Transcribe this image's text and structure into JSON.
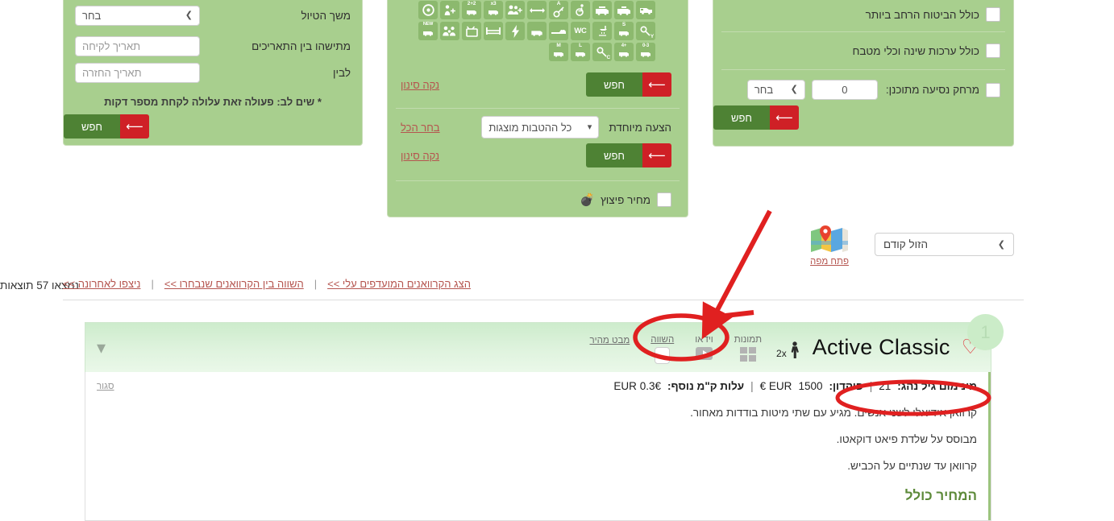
{
  "colors": {
    "panel_green": "#a8cf8e",
    "button_green": "#4e8234",
    "button_red": "#cf2026",
    "link_red": "#b5554f",
    "accent_green": "#5d8a39",
    "annotation_red": "#e02020"
  },
  "trip_panel": {
    "rows": [
      {
        "label": "משך הטיול",
        "value": "בחר",
        "type": "select"
      },
      {
        "label": "מתישהו בין התאריכים",
        "value": "תאריך לקיחה",
        "type": "date"
      },
      {
        "label": "לבין",
        "value": "תאריך החזרה",
        "type": "date"
      }
    ],
    "note": "* שים לב: פעולה זאת עלולה לקחת מספר דקות",
    "search_label": "חפש",
    "arrow_icon": "arrow-left-icon"
  },
  "features_panel": {
    "icons": [
      {
        "name": "van-icon",
        "sup": "",
        "text": ""
      },
      {
        "name": "camper-icon",
        "sup": "",
        "text": ""
      },
      {
        "name": "camper-plus-icon",
        "sup": "",
        "text": ""
      },
      {
        "name": "wheelchair-icon",
        "sup": "",
        "text": ""
      },
      {
        "name": "key-automatic-icon",
        "sup": "A",
        "text": ""
      },
      {
        "name": "length-icon",
        "sup": "",
        "text": ""
      },
      {
        "name": "people-plus-icon",
        "sup": "",
        "text": ""
      },
      {
        "name": "camper-x3-icon",
        "sup": "",
        "text": "x3"
      },
      {
        "name": "camper-2plus2-icon",
        "sup": "",
        "text": "2+2"
      },
      {
        "name": "person-plus-icon",
        "sup": "",
        "text": ""
      },
      {
        "name": "steering-wheel-icon",
        "sup": "",
        "text": ""
      },
      {
        "name": "key-young-icon",
        "sup": "",
        "text": "Y"
      },
      {
        "name": "camper-s-icon",
        "sup": "S",
        "text": ""
      },
      {
        "name": "shower-icon",
        "sup": "",
        "text": ""
      },
      {
        "name": "wc-icon",
        "sup": "",
        "text": "WC"
      },
      {
        "name": "pet-icon",
        "sup": "",
        "text": ""
      },
      {
        "name": "four-by-four-icon",
        "sup": "",
        "text": "4X4"
      },
      {
        "name": "electricity-icon",
        "sup": "",
        "text": ""
      },
      {
        "name": "bed-icon",
        "sup": "",
        "text": ""
      },
      {
        "name": "tv-icon",
        "sup": "",
        "text": ""
      },
      {
        "name": "family-icon",
        "sup": "",
        "text": ""
      },
      {
        "name": "camper-new-icon",
        "sup": "NEW",
        "text": ""
      },
      {
        "name": "camper-0to3-icon",
        "sup": "0-3",
        "text": ""
      },
      {
        "name": "camper-plus4-icon",
        "sup": "+4",
        "text": ""
      },
      {
        "name": "key-c-icon",
        "sup": "",
        "text": "C"
      },
      {
        "name": "camper-l-icon",
        "sup": "L",
        "text": ""
      },
      {
        "name": "camper-m-icon",
        "sup": "M",
        "text": ""
      }
    ],
    "clear_filter_label": "נקה סינון",
    "search_label": "חפש"
  },
  "offer_panel": {
    "label": "הצעה מיוחדת",
    "select_value": "כל ההטבות מוצגות",
    "select_all_label": "בחר הכל",
    "clear_filter_label": "נקה סינון",
    "search_label": "חפש"
  },
  "burst_panel": {
    "label": "מחיר פיצוץ",
    "icon": "bomb-icon",
    "checked": false
  },
  "insurance_panel": {
    "rows": [
      {
        "label": "כולל הביטוח הרחב ביותר",
        "checked": false
      },
      {
        "label": "כולל ערכות שינה וכלי מטבח",
        "checked": false
      }
    ],
    "distance_row": {
      "label": "מרחק נסיעה מתוכנן:",
      "value": "0",
      "unit_select": "בחר",
      "checked": false
    },
    "search_label": "חפש"
  },
  "nav_links": [
    "ניצפו לאחרונה >>",
    "השווה בין הקרוואנים שנבחרו >>",
    "הצג הקרוואנים המועדפים עלי >>"
  ],
  "nav_separator": "|",
  "results": {
    "sort_value": "הזול קודם",
    "count_text": "נמצאו 57 תוצאות",
    "map_link": "פתח מפה",
    "map_icon": "map-pin-icon"
  },
  "card": {
    "badge": "1",
    "title": "Active Classic",
    "favorite_icon": "heart-icon",
    "occupancy": "2x",
    "occupancy_icon": "person-icon",
    "tabs": [
      {
        "label": "מבט מהיר",
        "icon": "",
        "name": "quick-view"
      },
      {
        "label": "השווה",
        "icon": "compare-checkbox",
        "name": "compare"
      },
      {
        "label": "וידאו",
        "icon": "video-icon",
        "name": "video"
      },
      {
        "label": "תמונות",
        "icon": "gallery-icon",
        "name": "images"
      }
    ],
    "collapse_icon": "chevron-down-icon",
    "close_label": "סגור",
    "specs": {
      "min_age_label": "מינימום גיל נהג:",
      "min_age_value": "21",
      "deposit_label": "פיקדון:",
      "deposit_value": "1500",
      "deposit_currency": "EUR €",
      "extra_km_label": "עלות ק\"מ נוסף:",
      "extra_km_value": "0.3€ EUR"
    },
    "description": [
      "קרוואן אידיאלי לשני אנשים. מגיע עם שתי מיטות בודדות מאחור.",
      "מבוסס על שלדת פיאט דוקאטו.",
      "קרוואן עד שנתיים על הכביש."
    ],
    "price_includes_heading": "המחיר כולל"
  },
  "annotations": {
    "arrow": "red-arrow-annotation",
    "circle_quick_view": "red-circle-quick-view",
    "circle_min_age": "red-ellipse-min-age"
  }
}
